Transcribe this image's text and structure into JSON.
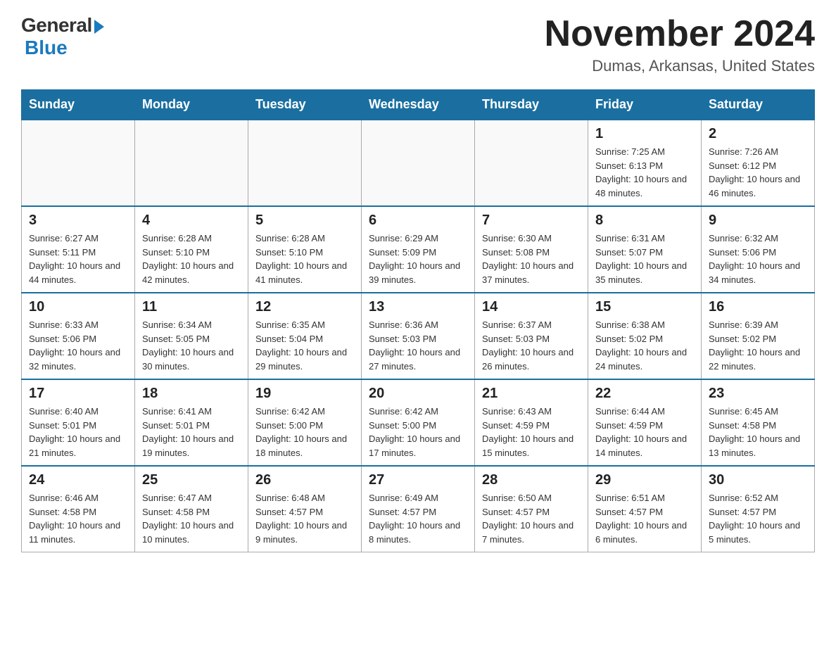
{
  "logo": {
    "general": "General",
    "blue": "Blue",
    "subtitle": "Blue"
  },
  "title": {
    "month_year": "November 2024",
    "location": "Dumas, Arkansas, United States"
  },
  "weekdays": [
    "Sunday",
    "Monday",
    "Tuesday",
    "Wednesday",
    "Thursday",
    "Friday",
    "Saturday"
  ],
  "weeks": [
    [
      {
        "day": "",
        "info": ""
      },
      {
        "day": "",
        "info": ""
      },
      {
        "day": "",
        "info": ""
      },
      {
        "day": "",
        "info": ""
      },
      {
        "day": "",
        "info": ""
      },
      {
        "day": "1",
        "info": "Sunrise: 7:25 AM\nSunset: 6:13 PM\nDaylight: 10 hours and 48 minutes."
      },
      {
        "day": "2",
        "info": "Sunrise: 7:26 AM\nSunset: 6:12 PM\nDaylight: 10 hours and 46 minutes."
      }
    ],
    [
      {
        "day": "3",
        "info": "Sunrise: 6:27 AM\nSunset: 5:11 PM\nDaylight: 10 hours and 44 minutes."
      },
      {
        "day": "4",
        "info": "Sunrise: 6:28 AM\nSunset: 5:10 PM\nDaylight: 10 hours and 42 minutes."
      },
      {
        "day": "5",
        "info": "Sunrise: 6:28 AM\nSunset: 5:10 PM\nDaylight: 10 hours and 41 minutes."
      },
      {
        "day": "6",
        "info": "Sunrise: 6:29 AM\nSunset: 5:09 PM\nDaylight: 10 hours and 39 minutes."
      },
      {
        "day": "7",
        "info": "Sunrise: 6:30 AM\nSunset: 5:08 PM\nDaylight: 10 hours and 37 minutes."
      },
      {
        "day": "8",
        "info": "Sunrise: 6:31 AM\nSunset: 5:07 PM\nDaylight: 10 hours and 35 minutes."
      },
      {
        "day": "9",
        "info": "Sunrise: 6:32 AM\nSunset: 5:06 PM\nDaylight: 10 hours and 34 minutes."
      }
    ],
    [
      {
        "day": "10",
        "info": "Sunrise: 6:33 AM\nSunset: 5:06 PM\nDaylight: 10 hours and 32 minutes."
      },
      {
        "day": "11",
        "info": "Sunrise: 6:34 AM\nSunset: 5:05 PM\nDaylight: 10 hours and 30 minutes."
      },
      {
        "day": "12",
        "info": "Sunrise: 6:35 AM\nSunset: 5:04 PM\nDaylight: 10 hours and 29 minutes."
      },
      {
        "day": "13",
        "info": "Sunrise: 6:36 AM\nSunset: 5:03 PM\nDaylight: 10 hours and 27 minutes."
      },
      {
        "day": "14",
        "info": "Sunrise: 6:37 AM\nSunset: 5:03 PM\nDaylight: 10 hours and 26 minutes."
      },
      {
        "day": "15",
        "info": "Sunrise: 6:38 AM\nSunset: 5:02 PM\nDaylight: 10 hours and 24 minutes."
      },
      {
        "day": "16",
        "info": "Sunrise: 6:39 AM\nSunset: 5:02 PM\nDaylight: 10 hours and 22 minutes."
      }
    ],
    [
      {
        "day": "17",
        "info": "Sunrise: 6:40 AM\nSunset: 5:01 PM\nDaylight: 10 hours and 21 minutes."
      },
      {
        "day": "18",
        "info": "Sunrise: 6:41 AM\nSunset: 5:01 PM\nDaylight: 10 hours and 19 minutes."
      },
      {
        "day": "19",
        "info": "Sunrise: 6:42 AM\nSunset: 5:00 PM\nDaylight: 10 hours and 18 minutes."
      },
      {
        "day": "20",
        "info": "Sunrise: 6:42 AM\nSunset: 5:00 PM\nDaylight: 10 hours and 17 minutes."
      },
      {
        "day": "21",
        "info": "Sunrise: 6:43 AM\nSunset: 4:59 PM\nDaylight: 10 hours and 15 minutes."
      },
      {
        "day": "22",
        "info": "Sunrise: 6:44 AM\nSunset: 4:59 PM\nDaylight: 10 hours and 14 minutes."
      },
      {
        "day": "23",
        "info": "Sunrise: 6:45 AM\nSunset: 4:58 PM\nDaylight: 10 hours and 13 minutes."
      }
    ],
    [
      {
        "day": "24",
        "info": "Sunrise: 6:46 AM\nSunset: 4:58 PM\nDaylight: 10 hours and 11 minutes."
      },
      {
        "day": "25",
        "info": "Sunrise: 6:47 AM\nSunset: 4:58 PM\nDaylight: 10 hours and 10 minutes."
      },
      {
        "day": "26",
        "info": "Sunrise: 6:48 AM\nSunset: 4:57 PM\nDaylight: 10 hours and 9 minutes."
      },
      {
        "day": "27",
        "info": "Sunrise: 6:49 AM\nSunset: 4:57 PM\nDaylight: 10 hours and 8 minutes."
      },
      {
        "day": "28",
        "info": "Sunrise: 6:50 AM\nSunset: 4:57 PM\nDaylight: 10 hours and 7 minutes."
      },
      {
        "day": "29",
        "info": "Sunrise: 6:51 AM\nSunset: 4:57 PM\nDaylight: 10 hours and 6 minutes."
      },
      {
        "day": "30",
        "info": "Sunrise: 6:52 AM\nSunset: 4:57 PM\nDaylight: 10 hours and 5 minutes."
      }
    ]
  ]
}
